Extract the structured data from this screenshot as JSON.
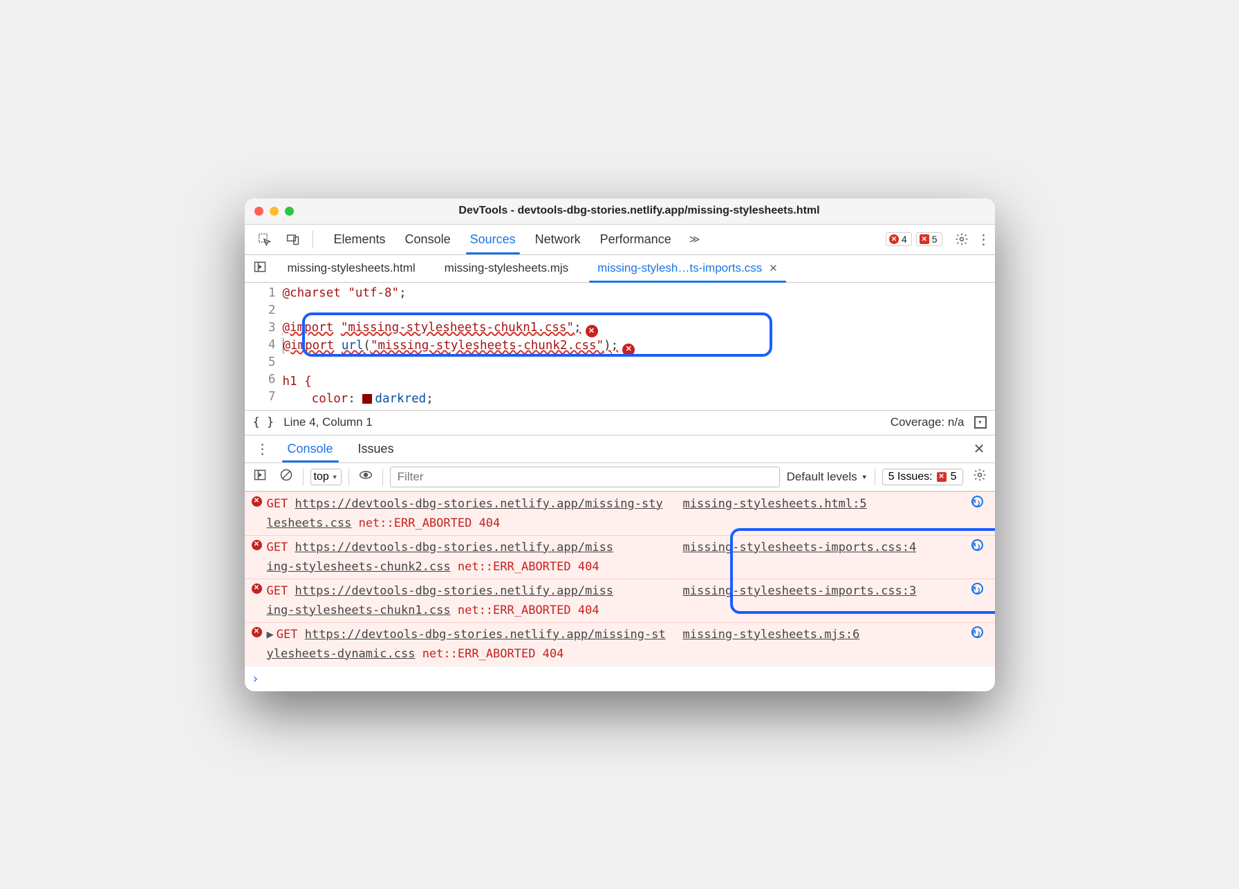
{
  "window": {
    "title": "DevTools - devtools-dbg-stories.netlify.app/missing-stylesheets.html"
  },
  "toolbar": {
    "panels": [
      "Elements",
      "Console",
      "Sources",
      "Network",
      "Performance"
    ],
    "active_panel": "Sources",
    "more": "≫",
    "error_badge": "4",
    "issues_badge": "5"
  },
  "file_tabs": {
    "tabs": [
      "missing-stylesheets.html",
      "missing-stylesheets.mjs",
      "missing-stylesh…ts-imports.css"
    ],
    "active": 2
  },
  "source": {
    "lines": [
      "1",
      "2",
      "3",
      "4",
      "5",
      "6",
      "7"
    ],
    "l1_a": "@charset",
    "l1_b": "\"utf-8\"",
    "l1_c": ";",
    "l3_a": "@import",
    "l3_b": "\"missing-stylesheets-chukn1.css\"",
    "l3_c": ";",
    "l4_a": "@import",
    "l4_b": "url",
    "l4_c": "(",
    "l4_d": "\"missing-stylesheets-chunk2.css\"",
    "l4_e": ")",
    "l4_f": ";",
    "l6_a": "h1 {",
    "l7_a": "    ",
    "l7_b": "color",
    "l7_c": ": ",
    "l7_d": "darkred",
    "l7_e": ";"
  },
  "status": {
    "braces": "{ }",
    "pos": "Line 4, Column 1",
    "coverage": "Coverage: n/a"
  },
  "drawer": {
    "tabs": [
      "Console",
      "Issues"
    ],
    "active": 0
  },
  "console_toolbar": {
    "context": "top",
    "filter_placeholder": "Filter",
    "levels": "Default levels",
    "issues_label": "5 Issues:",
    "issues_count": "5"
  },
  "console_messages": [
    {
      "get": "GET",
      "url_part1": "https://devtools-dbg-stories.netlify.app/missing-sty",
      "url_part2": "lesheets.css",
      "err": "net::ERR_ABORTED 404",
      "src": "missing-stylesheets.html:5",
      "expandable": false
    },
    {
      "get": "GET",
      "url_part1": "https://devtools-dbg-stories.netlify.app/miss",
      "url_part2": "ing-stylesheets-chunk2.css",
      "err": "net::ERR_ABORTED 404",
      "src": "missing-stylesheets-imports.css:4",
      "expandable": false
    },
    {
      "get": "GET",
      "url_part1": "https://devtools-dbg-stories.netlify.app/miss",
      "url_part2": "ing-stylesheets-chukn1.css",
      "err": "net::ERR_ABORTED 404",
      "src": "missing-stylesheets-imports.css:3",
      "expandable": false
    },
    {
      "get": "GET",
      "url_part1": "https://devtools-dbg-stories.netlify.app/missing-st",
      "url_part2": "ylesheets-dynamic.css",
      "err": "net::ERR_ABORTED 404",
      "src": "missing-stylesheets.mjs:6",
      "expandable": true
    }
  ]
}
